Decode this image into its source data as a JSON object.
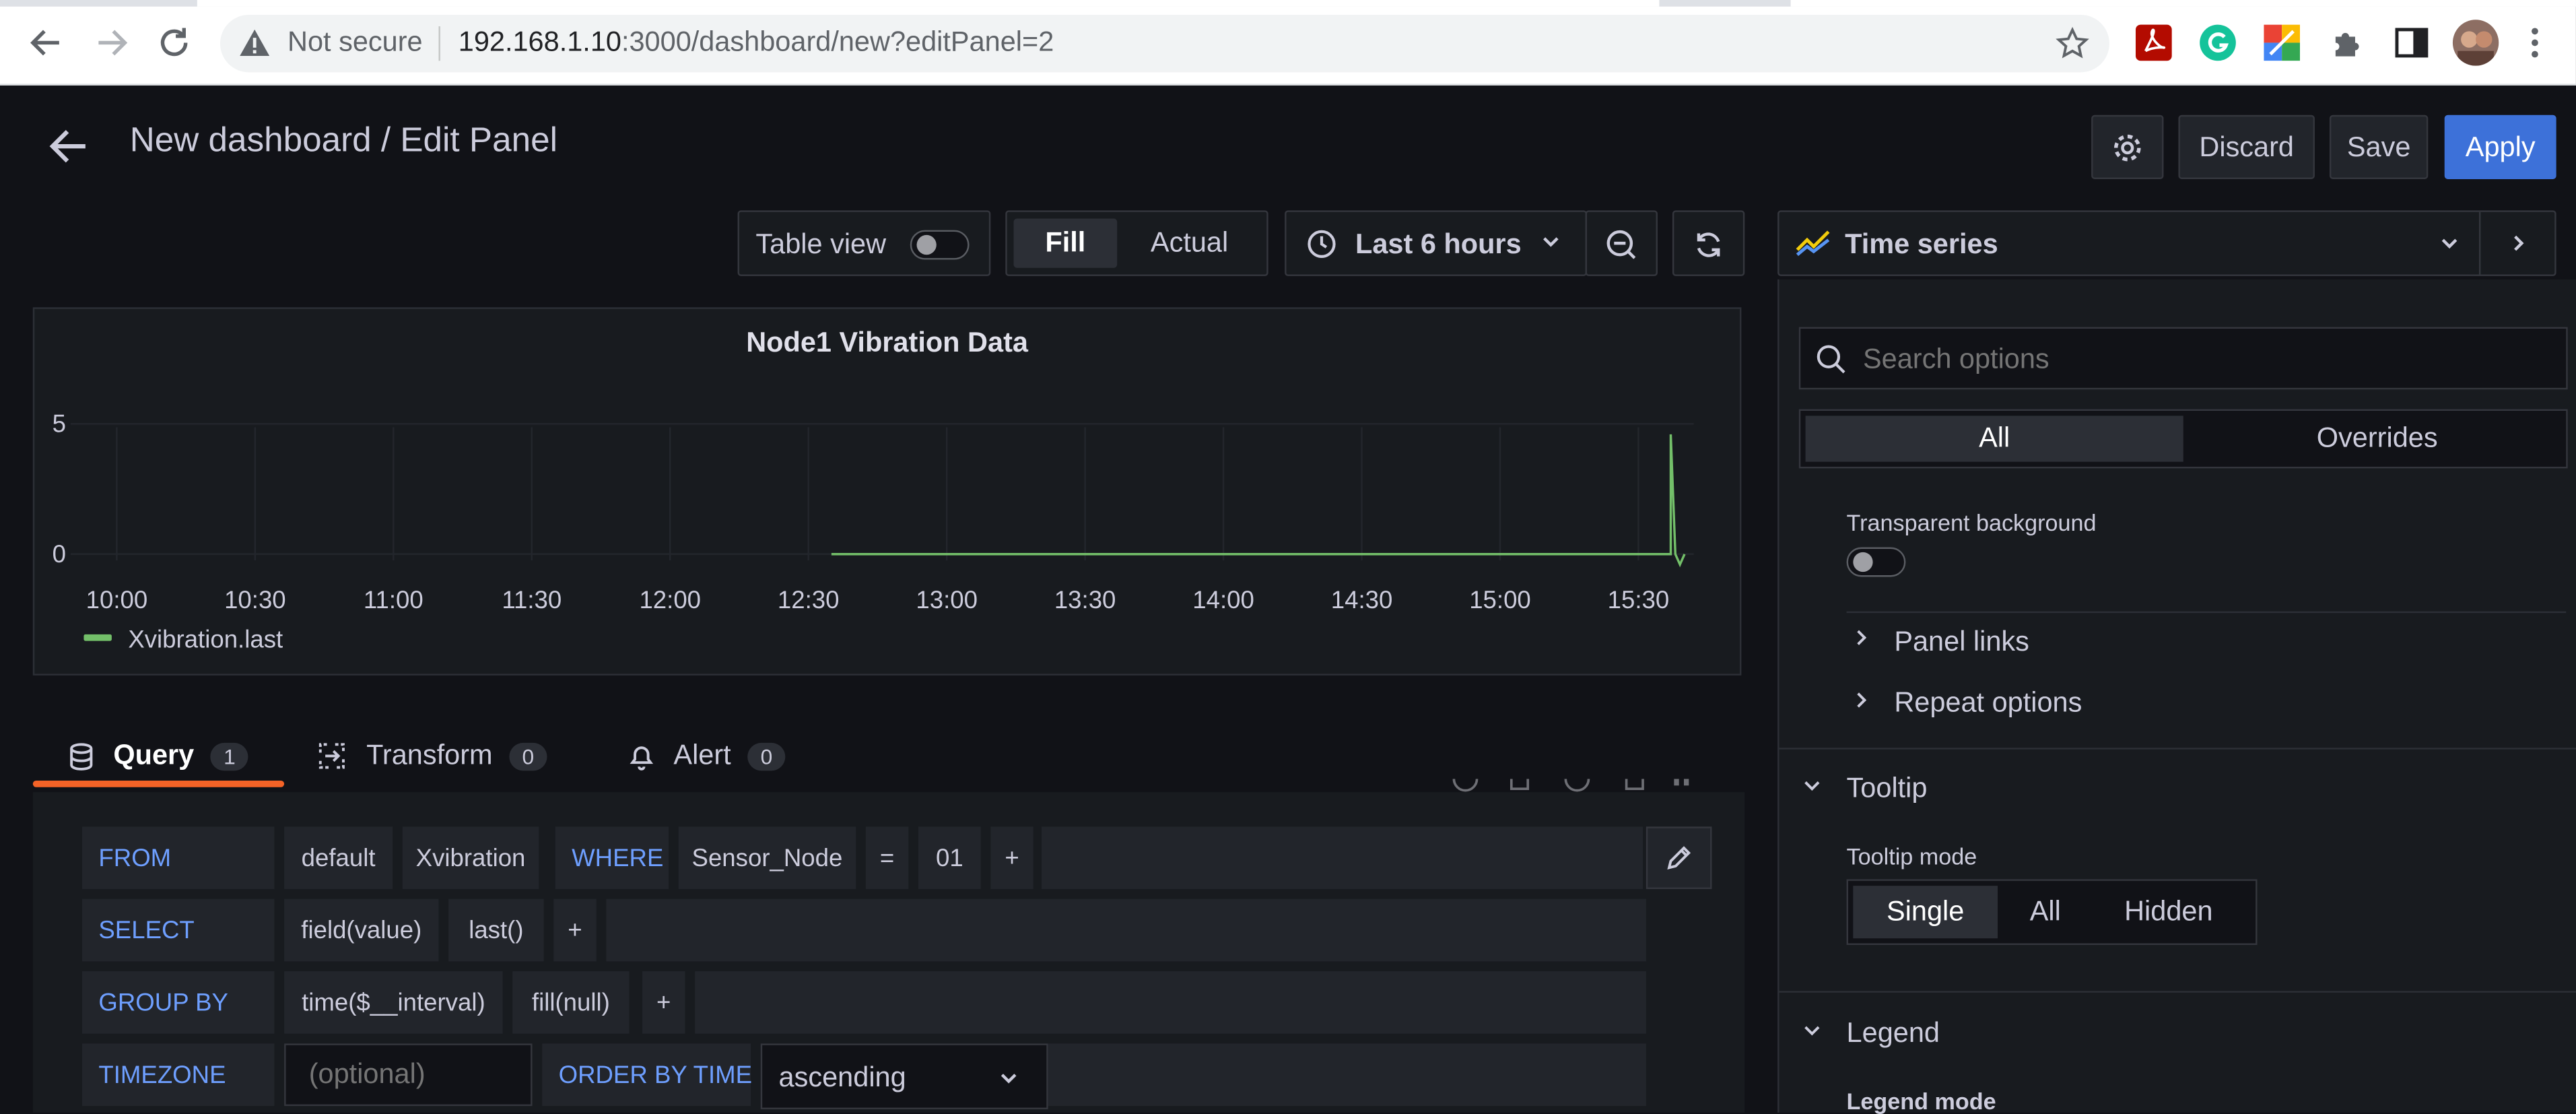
{
  "browser": {
    "security_label": "Not secure",
    "url_host": "192.168.1.10",
    "url_rest": ":3000/dashboard/new?editPanel=2"
  },
  "header": {
    "title": "New dashboard / Edit Panel",
    "discard": "Discard",
    "save": "Save",
    "apply": "Apply"
  },
  "toolbar": {
    "table_view": "Table view",
    "fill": "Fill",
    "actual": "Actual",
    "time_range": "Last 6 hours"
  },
  "visualization": {
    "name": "Time series"
  },
  "panel": {
    "title": "Node1 Vibration Data"
  },
  "chart_data": {
    "type": "line",
    "title": "Node1 Vibration Data",
    "x_ticks": [
      "10:00",
      "10:30",
      "11:00",
      "11:30",
      "12:00",
      "12:30",
      "13:00",
      "13:30",
      "14:00",
      "14:30",
      "15:00",
      "15:30"
    ],
    "y_ticks": [
      "5",
      "0"
    ],
    "ylim": [
      -1,
      5.5
    ],
    "grid": true,
    "legend_position": "bottom-left",
    "series": [
      {
        "name": "Xvibration.last",
        "color": "#73bf69",
        "points": [
          [
            "12:35",
            0.0
          ],
          [
            "13:00",
            0.0
          ],
          [
            "14:00",
            0.0
          ],
          [
            "15:00",
            0.0
          ],
          [
            "15:37",
            0.0
          ],
          [
            "15:37",
            4.6
          ],
          [
            "15:38",
            0.0
          ],
          [
            "15:39",
            -0.4
          ],
          [
            "15:40",
            0.0
          ]
        ]
      }
    ]
  },
  "tabs": [
    {
      "label": "Query",
      "count": "1"
    },
    {
      "label": "Transform",
      "count": "0"
    },
    {
      "label": "Alert",
      "count": "0"
    }
  ],
  "query": {
    "from": {
      "keyword": "FROM",
      "policy": "default",
      "measurement": "Xvibration",
      "where": "WHERE",
      "tag": "Sensor_Node",
      "operator": "=",
      "value": "01",
      "plus": "+"
    },
    "select": {
      "keyword": "SELECT",
      "field": "field(value)",
      "func": "last()",
      "plus": "+"
    },
    "group_by": {
      "keyword": "GROUP BY",
      "time": "time($__interval)",
      "fill": "fill(null)",
      "plus": "+"
    },
    "timezone": {
      "keyword": "TIMEZONE",
      "placeholder": "(optional)",
      "order_keyword": "ORDER BY TIME",
      "order_value": "ascending"
    }
  },
  "options": {
    "search_placeholder": "Search options",
    "tab_all": "All",
    "tab_overrides": "Overrides",
    "transparent_background": "Transparent background",
    "panel_links": "Panel links",
    "repeat_options": "Repeat options",
    "tooltip": "Tooltip",
    "tooltip_mode": "Tooltip mode",
    "tooltip_modes": [
      "Single",
      "All",
      "Hidden"
    ],
    "legend": "Legend",
    "legend_mode": "Legend mode"
  }
}
